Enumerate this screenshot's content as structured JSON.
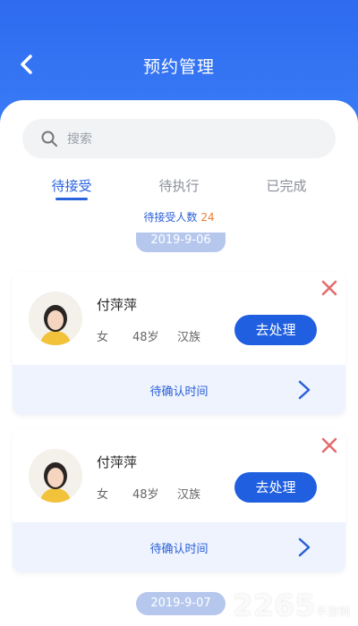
{
  "header": {
    "title": "预约管理"
  },
  "search": {
    "placeholder": "搜索"
  },
  "tabs": [
    {
      "label": "待接受",
      "active": true
    },
    {
      "label": "待执行",
      "active": false
    },
    {
      "label": "已完成",
      "active": false
    }
  ],
  "pending": {
    "label": "待接受人数",
    "count": "24"
  },
  "dates": [
    "2019-9-06",
    "2019-9-07"
  ],
  "cards": [
    {
      "name": "付萍萍",
      "gender": "女",
      "age": "48岁",
      "ethnicity": "汉族",
      "action": "去处理",
      "footer": "待确认时间"
    },
    {
      "name": "付萍萍",
      "gender": "女",
      "age": "48岁",
      "ethnicity": "汉族",
      "action": "去处理",
      "footer": "待确认时间"
    }
  ],
  "watermark": {
    "text": "2265",
    "sub": "手游网"
  },
  "colors": {
    "primary": "#1f5fe0",
    "header": "#2e6bf0",
    "accent_count": "#f07a3a",
    "close": "#e36b6b"
  }
}
